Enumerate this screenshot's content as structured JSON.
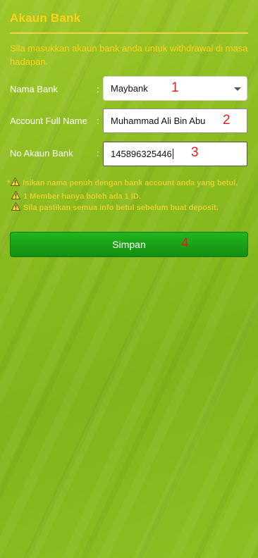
{
  "page": {
    "title": "Akaun Bank",
    "intro": "Sila masukkan akaun bank anda untuk withdrawal di masa hadapan."
  },
  "form": {
    "colon": ":",
    "bank": {
      "label": "Nama Bank",
      "value": "Maybank",
      "annotation": "1"
    },
    "full_name": {
      "label": "Account Full Name",
      "value": "Muhammad Ali Bin Abu",
      "annotation": "2"
    },
    "account_no": {
      "label": "No Akaun Bank",
      "value": "145896325446",
      "annotation": "3"
    }
  },
  "notes": {
    "star": "*",
    "items": [
      "Isikan nama penuh dengan bank account anda yang betul.",
      "1 Member hanya boleh ada 1 ID.",
      "Sila pastikan semua info betul sebelum buat deposit."
    ]
  },
  "actions": {
    "save_label": "Simpan",
    "save_annotation": "4"
  },
  "colors": {
    "background": "#8bbb1f",
    "title": "#ffd21a",
    "notes": "#e2cf2a",
    "button": "#1aa318",
    "annotation": "#e02020"
  },
  "icons": {
    "select": "chevron-down-icon",
    "warning": "warning-icon"
  }
}
